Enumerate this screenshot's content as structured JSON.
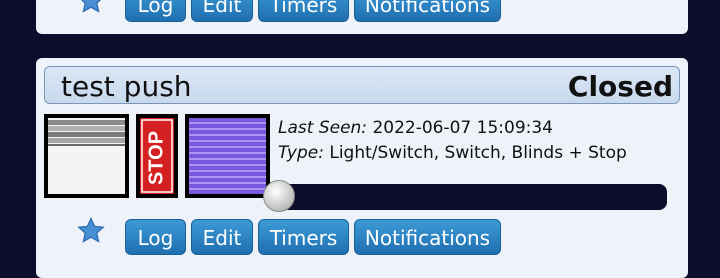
{
  "top_card": {
    "buttons": {
      "log": "Log",
      "edit": "Edit",
      "timers": "Timers",
      "notifications": "Notifications"
    }
  },
  "device": {
    "name": "test push",
    "state": "Closed",
    "last_seen_label": "Last Seen:",
    "last_seen_value": "2022-06-07 15:09:34",
    "type_label": "Type:",
    "type_value": "Light/Switch, Switch, Blinds + Stop",
    "stop_label": "STOP",
    "slider_level": 0,
    "buttons": {
      "log": "Log",
      "edit": "Edit",
      "timers": "Timers",
      "notifications": "Notifications"
    }
  },
  "icons": {
    "favorite": "star-icon",
    "open": "blinds-open-icon",
    "stop": "stop-icon",
    "close": "blinds-closed-icon"
  },
  "colors": {
    "page_bg": "#0d0c2b",
    "card_bg": "#eef2f9",
    "button": "#2a80c2",
    "stop": "#d42020",
    "blinds_closed": "#8d6ae8"
  }
}
